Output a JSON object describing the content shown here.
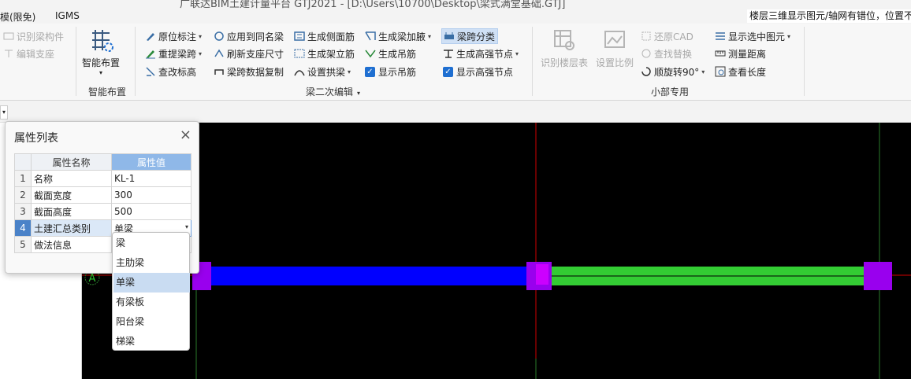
{
  "window": {
    "title_text": "广联达BIM土建计量平台 GTJ2021 - [D:\\Users\\10700\\Desktop\\梁式满堂基础.GTJ]",
    "tabs": [
      "模(限免)",
      "IGMS"
    ],
    "notice": "楼层三维显示图元/轴网有错位，位置不"
  },
  "ribbon": {
    "group1": {
      "items": [
        "识别梁构件",
        "编辑支座"
      ]
    },
    "smart": {
      "button": "智能布置",
      "label": "智能布置"
    },
    "beam_edit": {
      "col1": [
        "原位标注",
        "重提梁跨",
        "查改标高"
      ],
      "col2": [
        "应用到同名梁",
        "刷新支座尺寸",
        "梁跨数据复制"
      ],
      "col3": [
        "生成侧面筋",
        "生成架立筋",
        "设置拱梁"
      ],
      "col4": [
        "生成梁加腋",
        "生成吊筋",
        "显示吊筋"
      ],
      "col5": [
        "梁跨分类",
        "生成高强节点",
        "显示高强节点"
      ],
      "label": "梁二次编辑"
    },
    "small": {
      "big1": "识别楼层表",
      "big2": "设置比例",
      "col1": [
        "还原CAD",
        "查找替换",
        "顺旋转90°"
      ],
      "col2": [
        "显示选中图元",
        "测量距离",
        "查看长度"
      ],
      "label": "小部专用"
    }
  },
  "dialog": {
    "title": "属性列表",
    "headers": [
      "属性名称",
      "属性值"
    ],
    "rows": [
      {
        "idx": "1",
        "name": "名称",
        "value": "KL-1"
      },
      {
        "idx": "2",
        "name": "截面宽度",
        "value": "300"
      },
      {
        "idx": "3",
        "name": "截面高度",
        "value": "500"
      },
      {
        "idx": "4",
        "name": "土建汇总类别",
        "value": "单梁"
      },
      {
        "idx": "5",
        "name": "做法信息",
        "value": ""
      }
    ],
    "dropdown_options": [
      "梁",
      "主肋梁",
      "单梁",
      "有梁板",
      "阳台梁",
      "梯梁"
    ]
  },
  "canvas": {
    "axis_label": "A",
    "colors": {
      "beam_blue": "#0000ff",
      "beam_green": "#33cc33",
      "support": "#9900ee",
      "axis_red": "#d00000",
      "grid_green": "#2a7a2a"
    }
  }
}
